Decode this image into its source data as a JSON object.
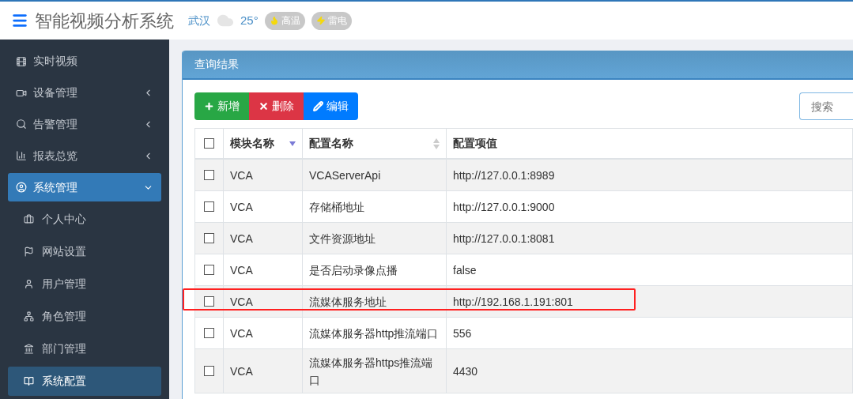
{
  "header": {
    "title": "智能视频分析系统",
    "city": "武汉",
    "temperature": "25°",
    "alerts": [
      "高温",
      "雷电"
    ]
  },
  "sidebar": {
    "items": [
      {
        "label": "实时视频",
        "selected": false
      },
      {
        "label": "设备管理",
        "selected": false,
        "expanded": false
      },
      {
        "label": "告警管理",
        "selected": false,
        "expanded": false
      },
      {
        "label": "报表总览",
        "selected": false,
        "expanded": false
      },
      {
        "label": "系统管理",
        "selected": true,
        "expanded": true,
        "children": [
          {
            "label": "个人中心",
            "selected": false
          },
          {
            "label": "网站设置",
            "selected": false
          },
          {
            "label": "用户管理",
            "selected": false
          },
          {
            "label": "角色管理",
            "selected": false
          },
          {
            "label": "部门管理",
            "selected": false
          },
          {
            "label": "系统配置",
            "selected": true
          }
        ]
      }
    ]
  },
  "panel": {
    "title": "查询结果",
    "buttons": [
      "新增",
      "删除",
      "编辑"
    ],
    "search": {
      "placeholder": "搜索"
    },
    "table": {
      "select_all": {
        "checked": false
      },
      "columns": [
        "模块名称",
        "配置名称",
        "配置项值"
      ],
      "rows": [
        {
          "checked": false,
          "highlighted": false,
          "cells": [
            "VCA",
            "VCAServerApi",
            "http://127.0.0.1:8989"
          ]
        },
        {
          "checked": false,
          "highlighted": false,
          "cells": [
            "VCA",
            "存储桶地址",
            "http://127.0.0.1:9000"
          ]
        },
        {
          "checked": false,
          "highlighted": false,
          "cells": [
            "VCA",
            "文件资源地址",
            "http://127.0.0.1:8081"
          ]
        },
        {
          "checked": false,
          "highlighted": false,
          "cells": [
            "VCA",
            "是否启动录像点播",
            "false"
          ]
        },
        {
          "checked": false,
          "highlighted": true,
          "cells": [
            "VCA",
            "流媒体服务地址",
            "http://192.168.1.191:801"
          ]
        },
        {
          "checked": false,
          "highlighted": false,
          "cells": [
            "VCA",
            "流媒体服务器http推流端口",
            "556"
          ]
        },
        {
          "checked": false,
          "highlighted": false,
          "cells": [
            "VCA",
            "流媒体服务器https推流端口",
            "4430"
          ]
        }
      ]
    }
  }
}
